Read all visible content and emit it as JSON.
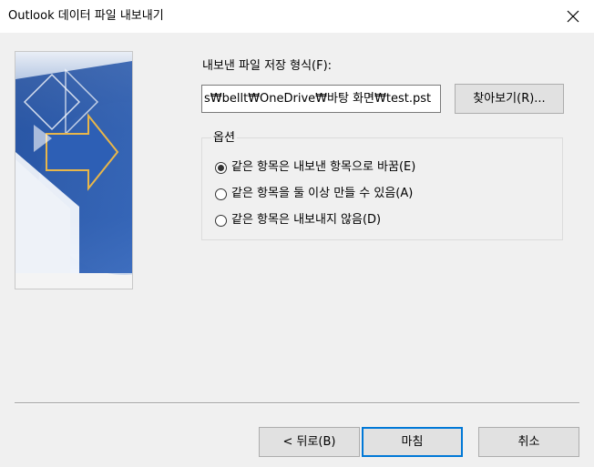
{
  "window": {
    "title": "Outlook 데이터 파일 내보내기",
    "close_glyph": "✕"
  },
  "save_format": {
    "label": "내보낸 파일 저장 형식(F):",
    "path_value": "s₩bellt₩OneDrive₩바탕 화면₩test.pst",
    "browse_label": "찾아보기(R)..."
  },
  "options": {
    "legend": "옵션",
    "items": [
      {
        "label": "같은 항목은 내보낸 항목으로 바꿈(E)",
        "checked": true
      },
      {
        "label": "같은 항목을 둘 이상 만들 수 있음(A)",
        "checked": false
      },
      {
        "label": "같은 항목은 내보내지 않음(D)",
        "checked": false
      }
    ]
  },
  "footer": {
    "back_label": "< 뒤로(B)",
    "finish_label": "마침",
    "cancel_label": "취소"
  },
  "colors": {
    "accent": "#0078d7",
    "wizard_blue": "#2f5da8",
    "wizard_arrow": "#e8b64a"
  }
}
